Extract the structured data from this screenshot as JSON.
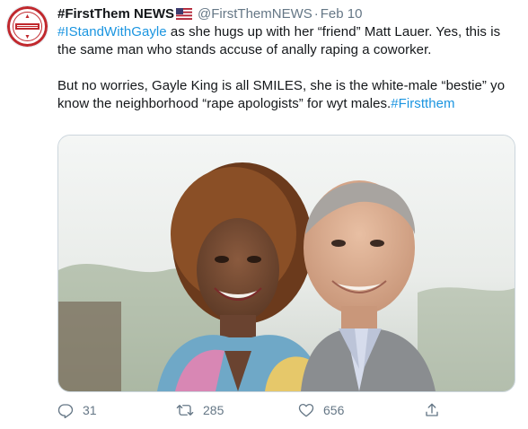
{
  "tweet": {
    "display_name": "#FirstThem NEWS",
    "handle": "@FirstThemNEWS",
    "separator": "·",
    "date": "Feb 10",
    "line1_hashtag": "#IStandWithGayle",
    "line1_rest": " as she hugs up with her “friend”  Matt Lauer. Yes, this is the same man who stands accuse of anally raping a coworker.",
    "para2_text": "But no worries, Gayle King is all SMILES, she is the white-male “bestie”  yo know the neighborhood  “rape apologists”  for wyt males.",
    "para2_hashtag": "#Firstthem",
    "counts": {
      "replies": "31",
      "retweets": "285",
      "likes": "656"
    },
    "icons": {
      "reply": "reply-icon",
      "retweet": "retweet-icon",
      "like": "heart-icon",
      "share": "share-icon",
      "flag": "us-flag-icon",
      "avatar": "avatar-logo"
    },
    "colors": {
      "link": "#1b95e0",
      "secondary_text": "#657786",
      "primary_text": "#14171a",
      "avatar_ring": "#c0282d"
    }
  }
}
